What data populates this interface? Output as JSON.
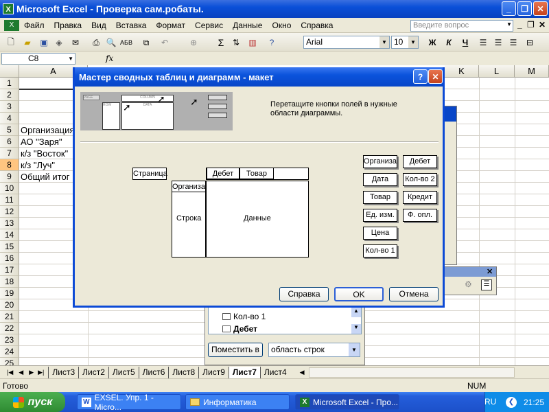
{
  "window": {
    "title": "Microsoft Excel - Проверка сам.робаты.",
    "minimize": "_",
    "restore": "❐",
    "close": "✕"
  },
  "menu": {
    "items": [
      "Файл",
      "Правка",
      "Вид",
      "Вставка",
      "Формат",
      "Сервис",
      "Данные",
      "Окно",
      "Справка"
    ],
    "ask_placeholder": "Введите вопрос"
  },
  "toolbar": {
    "font_name": "Arial",
    "font_size": "10",
    "bold": "Ж",
    "italic": "К",
    "underline": "Ч",
    "sigma": "Σ"
  },
  "formula": {
    "name_box": "C8",
    "fx": "fx"
  },
  "grid": {
    "columns": [
      "A",
      "K",
      "L",
      "M"
    ],
    "rows": [
      "1",
      "2",
      "3",
      "4",
      "5",
      "6",
      "7",
      "8",
      "9",
      "10",
      "11",
      "12",
      "13",
      "14",
      "15",
      "16",
      "17",
      "18",
      "19",
      "20",
      "21",
      "22",
      "23",
      "24",
      "25"
    ],
    "cells": [
      "Организация",
      "АО \"Заря\"",
      "к/з \"Восток\"",
      "к/з \"Луч\"",
      "Общий итог"
    ]
  },
  "sheets": {
    "tabs": [
      "Лист3",
      "Лист2",
      "Лист5",
      "Лист6",
      "Лист8",
      "Лист9",
      "Лист7",
      "Лист4"
    ],
    "active": "Лист7"
  },
  "status": {
    "left": "Готово",
    "num": "NUM"
  },
  "fieldlist_panel": {
    "items": [
      "Кол-во 1",
      "Дебет"
    ],
    "place_button": "Поместить в",
    "place_option": "область строк"
  },
  "dialog": {
    "title": "Мастер сводных таблиц и диаграмм - макет",
    "help_icon": "?",
    "close_icon": "✕",
    "instruction": "Перетащите кнопки полей в нужные области диаграммы.",
    "preview_labels": [
      "PAGE",
      "ROW",
      "DATA",
      "COLUMN"
    ],
    "page_area": "Страница",
    "row_field": "Организация",
    "col_fields": [
      "Дебет",
      "Товар"
    ],
    "row_area": "Строка",
    "data_area": "Данные",
    "fields_col1": [
      "Организация",
      "Дата",
      "Товар",
      "Ед. изм.",
      "Цена",
      "Кол-во 1"
    ],
    "fields_col2": [
      "Дебет",
      "Кол-во 2",
      "Кредит",
      "Ф. опл."
    ],
    "buttons": {
      "help": "Справка",
      "ok": "OK",
      "cancel": "Отмена"
    }
  },
  "taskbar": {
    "start": "пуск",
    "tasks": [
      "EXSEL. Упр. 1 - Micro...",
      "Информатика",
      "Microsoft Excel - Про..."
    ],
    "lang": "RU",
    "time": "21:25"
  }
}
